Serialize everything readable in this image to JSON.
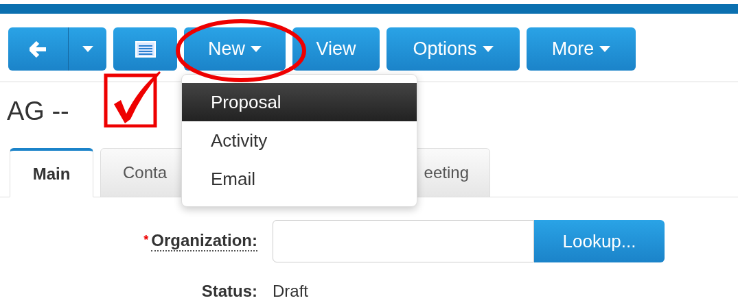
{
  "toolbar": [
    {
      "kind": "back"
    },
    {
      "kind": "list"
    },
    {
      "kind": "menu",
      "label": "New"
    },
    {
      "kind": "plain",
      "label": "View"
    },
    {
      "kind": "menu",
      "label": "Options"
    },
    {
      "kind": "menu",
      "label": "More"
    }
  ],
  "dropdown_menu": {
    "items": [
      {
        "label": "Proposal",
        "selected": true
      },
      {
        "label": "Activity",
        "selected": false
      },
      {
        "label": "Email",
        "selected": false
      }
    ]
  },
  "title": "AG --",
  "tabs": [
    {
      "label": "Main",
      "selected": true
    },
    {
      "label": "Conta",
      "selected": false
    },
    {
      "label": "eeting",
      "selected": false
    }
  ],
  "form": {
    "organization": {
      "required_mark": "*",
      "label": "Organization:",
      "button": "Lookup..."
    },
    "status": {
      "label": "Status:",
      "value": "Draft"
    }
  }
}
